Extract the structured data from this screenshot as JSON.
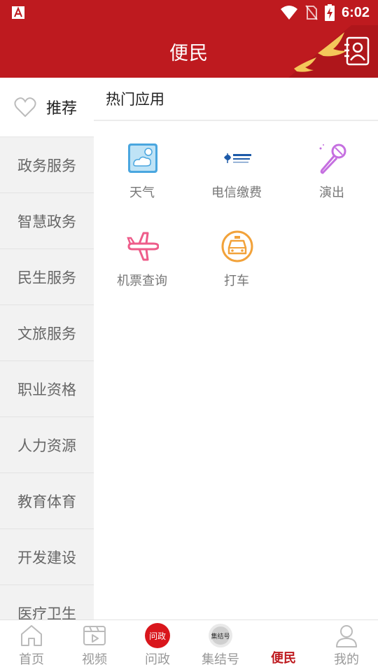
{
  "status": {
    "time": "6:02"
  },
  "header": {
    "title": "便民"
  },
  "sidebar": {
    "items": [
      {
        "label": "推荐",
        "active": true
      },
      {
        "label": "政务服务"
      },
      {
        "label": "智慧政务"
      },
      {
        "label": "民生服务"
      },
      {
        "label": "文旅服务"
      },
      {
        "label": "职业资格"
      },
      {
        "label": "人力资源"
      },
      {
        "label": "教育体育"
      },
      {
        "label": "开发建设"
      },
      {
        "label": "医疗卫生"
      }
    ]
  },
  "main": {
    "section_title": "热门应用",
    "apps": [
      {
        "label": "天气",
        "icon": "weather-icon"
      },
      {
        "label": "电信缴费",
        "icon": "china-telecom-logo"
      },
      {
        "label": "演出",
        "icon": "microphone-icon"
      },
      {
        "label": "机票查询",
        "icon": "airplane-icon"
      },
      {
        "label": "打车",
        "icon": "taxi-icon"
      }
    ]
  },
  "tabbar": {
    "items": [
      {
        "label": "首页",
        "icon": "home-icon"
      },
      {
        "label": "视频",
        "icon": "video-icon"
      },
      {
        "label": "问政",
        "icon": "wenzheng-logo",
        "logo_text": "问政"
      },
      {
        "label": "集结号",
        "icon": "jijiehao-logo",
        "logo_text": "集结号"
      },
      {
        "label": "便民",
        "icon": "bianmin-icon",
        "active": true
      },
      {
        "label": "我的",
        "icon": "profile-icon"
      }
    ]
  },
  "colors": {
    "brand": "#be1a1f",
    "sidebar_bg": "#f2f2f2",
    "inactive_text": "#999999"
  }
}
